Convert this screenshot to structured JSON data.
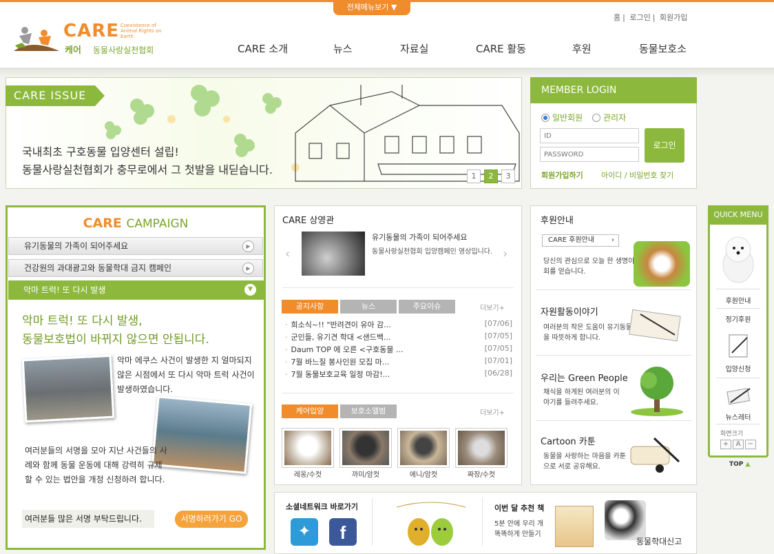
{
  "header": {
    "all_menu": "전체메뉴보기 ▼",
    "logo_main": "CARE",
    "logo_tagline": "Coexistence of Animal Rights on Earth",
    "logo_kr": "케어",
    "logo_kr2": "동물사랑실천협회",
    "util": [
      "홈",
      "로그인",
      "회원가입"
    ],
    "nav": [
      "CARE 소개",
      "뉴스",
      "자료실",
      "CARE 활동",
      "후원",
      "동물보호소"
    ]
  },
  "issue": {
    "tag": "CARE ISSUE",
    "line1": "국내최초 구호동물 입양센터 설립!",
    "line2": "동물사랑실천협회가 충무로에서 그 첫발을 내딛습니다.",
    "pages": [
      "1",
      "2",
      "3"
    ]
  },
  "login": {
    "title": "MEMBER LOGIN",
    "radio_member": "일반회원",
    "radio_admin": "관리자",
    "id_placeholder": "ID",
    "pw_placeholder": "PASSWORD",
    "button": "로그인",
    "join": "회원가입하기",
    "find": "아이디 / 비밀번호 찾기"
  },
  "campaign": {
    "title_care": "CARE",
    "title_rest": "CAMPAIGN",
    "items": [
      "유기동물의 가족이 되어주세요",
      "건강원의 과대광고와 동물학대 금지 캠페인"
    ],
    "active": "악마 트럭! 또 다시 발생",
    "headline1": "악마 트럭! 또 다시 발생,",
    "headline2": "동물보호법이 바뀌지 않으면 안됩니다.",
    "para1": "악마 에쿠스 사건이 발생한 지 얼마되지 않은 시점에서 또 다시 악마 트럭 사건이 발생하였습니다.",
    "para2": "여러분들의 서명을 모아 지난 사건들의 사례와 함께 동물 운동에 대해 강력히 규제할 수 있는 법안을 개정 신청하려 합니다.",
    "ask": "여러분들 많은 서명 부탁드립니다.",
    "sign_button": "서명하러가기 GO"
  },
  "theater": {
    "title": "CARE 상영관",
    "video_title": "유기동물의 가족이 되어주세요",
    "video_desc": "동물사랑실천협회 입양캠페인 영상입니다."
  },
  "news": {
    "tabs": [
      "공지사항",
      "뉴스",
      "주요이슈"
    ],
    "more": "더보기",
    "items": [
      {
        "title": "희소식~!! \"반려견이 유아 감...",
        "date": "[07/06]"
      },
      {
        "title": "군인들, 유기견 학대 <샌드백...",
        "date": "[07/05]"
      },
      {
        "title": "Daum TOP 에 오른 <구호동물 ...",
        "date": "[07/05]"
      },
      {
        "title": "7월 바느질 봉사인원 모집 마...",
        "date": "[07/01]"
      },
      {
        "title": "7월 동물보호교육 일정 마감!...",
        "date": "[06/28]"
      }
    ]
  },
  "album": {
    "tabs": [
      "케어입양",
      "보호소앨범"
    ],
    "more": "더보기",
    "pets": [
      "레옹/수컷",
      "까미/암컷",
      "에니/암컷",
      "짜장/수컷"
    ]
  },
  "right": {
    "sponsor_title": "후원안내",
    "sponsor_btn": "CARE 후원안내",
    "sponsor_desc": "당신의 관심으로 오늘 한 생명이 기회를 얻습니다.",
    "volunteer_title": "자원활동이야기",
    "volunteer_desc": "여러분의 작은 도움이 유기동물들의 마음을 따뜻하게 합니다.",
    "green_title": "우리는 Green People",
    "green_desc": "채식을 하게된 여러분의 이야기를 들려주세요.",
    "cartoon_title": "Cartoon 카툰",
    "cartoon_desc": "동물을 사랑하는 마음을 카툰으로 서로 공유해요."
  },
  "quick": {
    "title": "QUICK MENU",
    "items": [
      "후원안내",
      "정기후원",
      "입양신청",
      "뉴스레터"
    ],
    "zoom": "화면크기",
    "zoom_btns": [
      "+",
      "A",
      "−"
    ],
    "top": "TOP"
  },
  "bottom": {
    "sns_title": "소셜네트워크 바로가기",
    "book_title": "이번 달 추천 책",
    "book_desc": "5분 안에 우리 개 똑똑하게 만들기",
    "adopt": "동물학대신고"
  },
  "colors": {
    "accent_green": "#8db83e",
    "accent_orange": "#f08c2c"
  }
}
